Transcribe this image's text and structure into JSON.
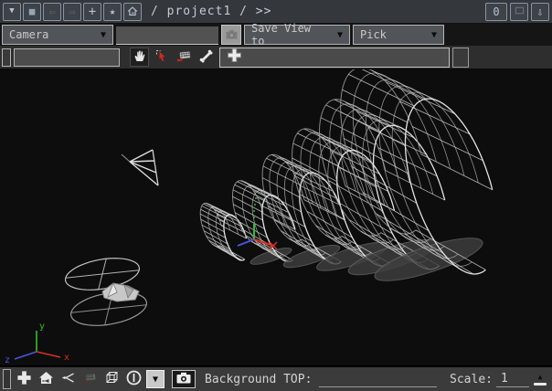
{
  "topbar": {
    "breadcrumb": "/ project1 / >>",
    "counter": "0"
  },
  "viewbar": {
    "camera_select": "Camera",
    "view_name_field": "",
    "save_view_to": "Save View to",
    "pick": "Pick"
  },
  "statusbar": {
    "background_top_label": "Background TOP:",
    "background_top_value": "",
    "scale_label": "Scale:",
    "scale_value": "1"
  },
  "viewport": {
    "axis": {
      "x_label": "x",
      "y_label": "y",
      "z_label": "z"
    },
    "colors": {
      "x_axis": "#d92f24",
      "y_axis": "#2fbe2f",
      "z_axis": "#4a55dd",
      "wireframe": "#e3e3e3",
      "wireframe_dim": "#969696",
      "background": "#0d0d0d"
    }
  },
  "icons": {
    "dropdown_tri": "▼",
    "stop_square": "■",
    "back_arrow": "⇦",
    "forward_arrow": "⇨",
    "plus": "+",
    "star": "★",
    "down_arrow": "⇩",
    "spinner_up": "▲"
  },
  "ui_colors": {
    "topbar_bg": "#34373c",
    "toolbar_bg": "#2e2e2e",
    "statusbar_bg": "#3b3b3b",
    "accent_select_red": "#d42a1e"
  }
}
